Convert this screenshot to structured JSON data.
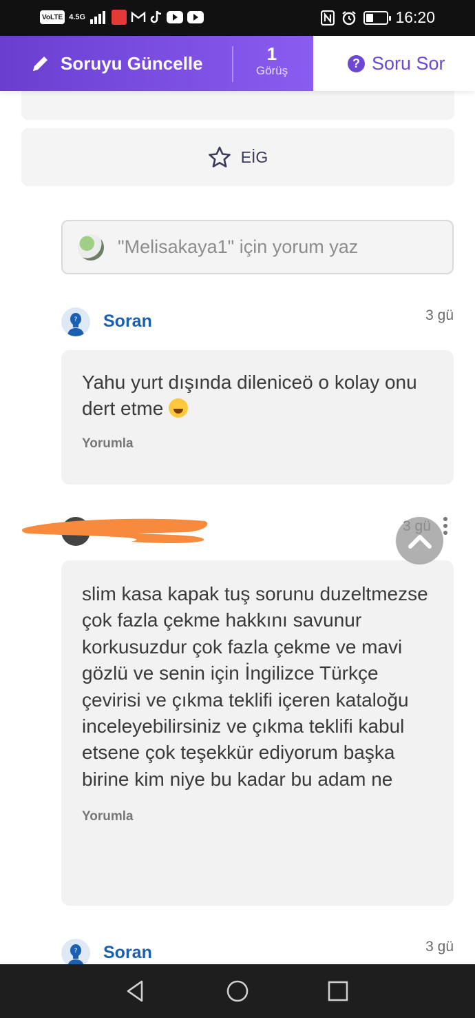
{
  "status_bar": {
    "volte": "VoLTE",
    "network": "4.5G",
    "time": "16:20",
    "battery_level": 0.3
  },
  "topbar": {
    "edit_label": "Soruyu Güncelle",
    "views_count": "1",
    "views_label": "Görüş",
    "ask_label": "Soru Sor"
  },
  "eig": {
    "label": "EİG"
  },
  "comment_input": {
    "placeholder": "\"Melisakaya1\" için yorum yaz"
  },
  "comments": [
    {
      "author": "Soran",
      "time": "3 gü",
      "text": "Yahu yurt dışında dileniceö o kolay onu dert etme",
      "reply_label": "Yorumla"
    },
    {
      "author": "",
      "time": "3 gü",
      "text": "slim kasa kapak tuş sorunu duzeltmezse çok fazla çekme hakkını savunur korkusuzdur çok fazla çekme ve mavi gözlü ve senin için İngilizce Türkçe çevirisi ve çıkma teklifi içeren kataloğu inceleyebilirsiniz ve çıkma teklifi kabul etsene çok teşekkür ediyorum başka birine kim niye bu kadar bu adam ne",
      "reply_label": "Yorumla"
    },
    {
      "author": "Soran",
      "time": "3 gü"
    }
  ],
  "colors": {
    "brand_purple": "#6c47d6",
    "asker_blue": "#1b5fb0",
    "redaction_orange": "#f78a3c"
  }
}
